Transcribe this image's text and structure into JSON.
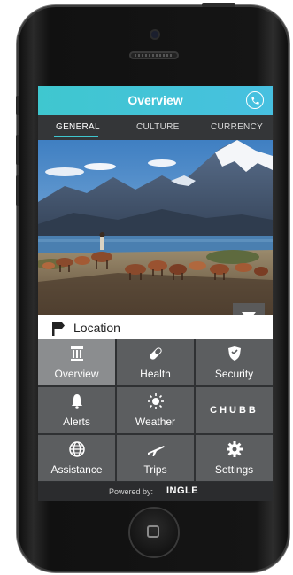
{
  "app": {
    "title": "Overview",
    "accent_color": "#3fc7cf",
    "call_icon": "phone-icon"
  },
  "tabs": [
    {
      "label": "GENERAL",
      "selected": true
    },
    {
      "label": "CULTURE",
      "selected": false
    },
    {
      "label": "CURRENCY",
      "selected": false
    }
  ],
  "hero": {
    "image": "mountain-lake-horses-photo",
    "dropdown_icon": "triangle-down-icon"
  },
  "location": {
    "label": "Location",
    "icon": "signpost-icon"
  },
  "grid": {
    "items": [
      {
        "label": "Overview",
        "icon": "pillar-icon",
        "active": true
      },
      {
        "label": "Health",
        "icon": "pill-icon",
        "active": false
      },
      {
        "label": "Security",
        "icon": "shield-icon",
        "active": false
      },
      {
        "label": "Alerts",
        "icon": "bell-icon",
        "active": false
      },
      {
        "label": "Weather",
        "icon": "sun-icon",
        "active": false
      },
      {
        "label": "CHUBB",
        "icon": "chubb-logo",
        "active": false
      },
      {
        "label": "Assistance",
        "icon": "globe-icon",
        "active": false
      },
      {
        "label": "Trips",
        "icon": "airplane-icon",
        "active": false
      },
      {
        "label": "Settings",
        "icon": "gear-icon",
        "active": false
      }
    ]
  },
  "footer": {
    "powered_by": "Powered by:",
    "brand": "INGLE"
  }
}
